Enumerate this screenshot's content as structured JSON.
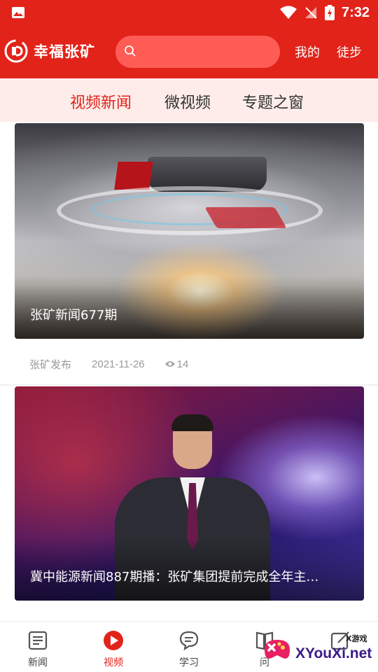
{
  "status_bar": {
    "time": "7:32"
  },
  "header": {
    "app_title": "幸福张矿",
    "search_placeholder": "",
    "mine_label": "我的",
    "walk_label": "徒步"
  },
  "tabs": [
    {
      "label": "视频新闻",
      "active": true
    },
    {
      "label": "微视频",
      "active": false
    },
    {
      "label": "专题之窗",
      "active": false
    }
  ],
  "feed": [
    {
      "title": "张矿新闻677期",
      "source": "张矿发布",
      "date": "2021-11-26",
      "views": "14"
    },
    {
      "title": "冀中能源新闻887期播：张矿集团提前完成全年主…"
    }
  ],
  "bottom_nav": [
    {
      "label": "新闻",
      "icon": "news-icon",
      "active": false
    },
    {
      "label": "视频",
      "icon": "play-icon",
      "active": true
    },
    {
      "label": "学习",
      "icon": "chat-icon",
      "active": false
    },
    {
      "label": "问",
      "icon": "book-icon",
      "active": false
    },
    {
      "label": "",
      "icon": "edit-icon",
      "active": false
    }
  ],
  "watermark": {
    "text": "XYouXi.net",
    "small": "X游戏"
  },
  "colors": {
    "brand_red": "#e2231a",
    "tab_bg": "#fdecea",
    "meta_gray": "#9a9a9a"
  }
}
